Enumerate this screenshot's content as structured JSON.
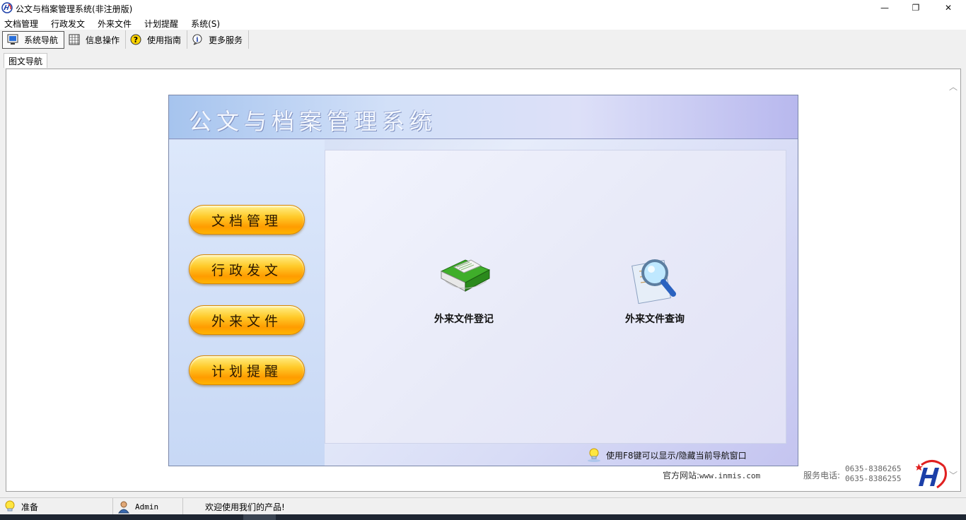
{
  "window": {
    "title": "公文与档案管理系统(非注册版)",
    "minimize": "—",
    "restore": "❐",
    "close": "✕"
  },
  "menu": [
    "文档管理",
    "行政发文",
    "外来文件",
    "计划提醒",
    "系统(S)"
  ],
  "toolbar": [
    {
      "label": "系统导航",
      "icon": "monitor-icon"
    },
    {
      "label": "信息操作",
      "icon": "grid-icon"
    },
    {
      "label": "使用指南",
      "icon": "help-icon"
    },
    {
      "label": "更多服务",
      "icon": "info-icon"
    }
  ],
  "tabs": [
    "图文导航"
  ],
  "panel": {
    "title": "公文与档案管理系统",
    "nav_buttons": [
      "文档管理",
      "行政发文",
      "外来文件",
      "计划提醒"
    ],
    "work_items": [
      {
        "label": "外来文件登记",
        "icon": "green-book-icon"
      },
      {
        "label": "外来文件查询",
        "icon": "magnifier-icon"
      }
    ],
    "hint": "使用F8键可以显示/隐藏当前导航窗口"
  },
  "footer": {
    "website_label": "官方网站:",
    "website": "www.inmis.com",
    "phone_label": "服务电话:",
    "phones": [
      "0635-8386265",
      "0635-8386255"
    ]
  },
  "statusbar": {
    "status": "准备",
    "user": "Admin",
    "message": "欢迎使用我们的产品!"
  },
  "colors": {
    "accent_orange": "#ff9c00",
    "panel_blue": "#c8d6f2",
    "logo_red": "#e02020",
    "logo_blue": "#1c3fa8"
  }
}
